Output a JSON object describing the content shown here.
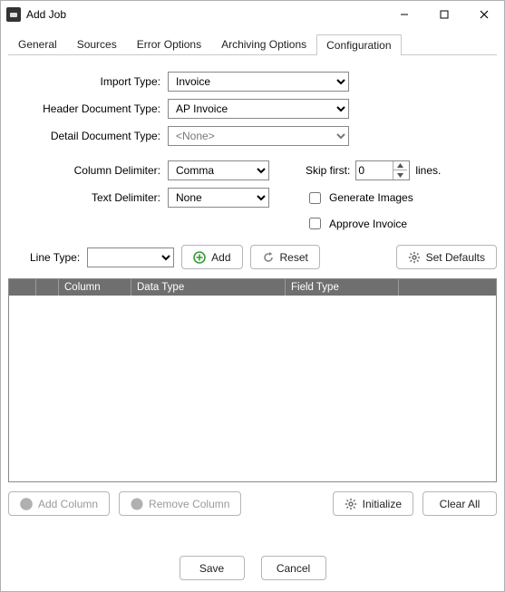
{
  "window": {
    "title": "Add Job"
  },
  "tabs": [
    {
      "label": "General"
    },
    {
      "label": "Sources"
    },
    {
      "label": "Error Options"
    },
    {
      "label": "Archiving Options"
    },
    {
      "label": "Configuration",
      "active": true
    }
  ],
  "fields": {
    "import_type": {
      "label": "Import Type:",
      "value": "Invoice"
    },
    "header_doc_type": {
      "label": "Header Document Type:",
      "value": "AP Invoice"
    },
    "detail_doc_type": {
      "label": "Detail Document Type:",
      "placeholder": "<None>",
      "value": ""
    },
    "column_delimiter": {
      "label": "Column Delimiter:",
      "value": "Comma"
    },
    "text_delimiter": {
      "label": "Text Delimiter:",
      "value": "None"
    },
    "skip_first": {
      "label": "Skip first:",
      "value": "0",
      "suffix": "lines."
    },
    "generate_images": {
      "label": "Generate Images",
      "checked": false
    },
    "approve_invoice": {
      "label": "Approve Invoice",
      "checked": false
    },
    "line_type": {
      "label": "Line Type:",
      "value": ""
    }
  },
  "buttons": {
    "add": "Add",
    "reset": "Reset",
    "set_defaults": "Set Defaults",
    "add_column": "Add Column",
    "remove_column": "Remove Column",
    "initialize": "Initialize",
    "clear_all": "Clear All",
    "save": "Save",
    "cancel": "Cancel"
  },
  "grid": {
    "columns": [
      "",
      "Column",
      "Data Type",
      "Field Type",
      ""
    ]
  }
}
